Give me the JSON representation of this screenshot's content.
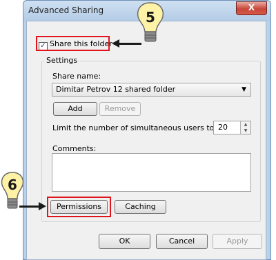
{
  "window": {
    "title": "Advanced Sharing",
    "close_label": "X"
  },
  "share": {
    "checkbox_label": "Share this folder",
    "checked": true
  },
  "settings": {
    "group_label": "Settings",
    "share_name_label": "Share name:",
    "share_name_value": "Dimitar Petrov 12 shared folder",
    "add_label": "Add",
    "remove_label": "Remove",
    "limit_label": "Limit the number of simultaneous users to:",
    "limit_value": "20",
    "comments_label": "Comments:",
    "permissions_label": "Permissions",
    "caching_label": "Caching"
  },
  "footer": {
    "ok_label": "OK",
    "cancel_label": "Cancel",
    "apply_label": "Apply"
  },
  "callouts": [
    {
      "number": "5",
      "target": "share-checkbox"
    },
    {
      "number": "6",
      "target": "permissions-button"
    }
  ],
  "colors": {
    "highlight": "#e0141b",
    "bulb": "#fdf2a6",
    "window_frame": "#b9d1ea"
  }
}
